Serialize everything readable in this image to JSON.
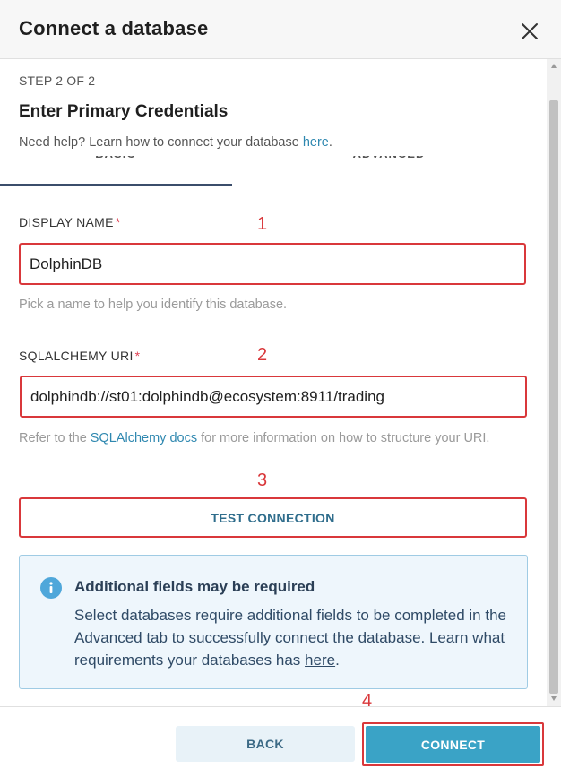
{
  "modal": {
    "title": "Connect a database",
    "close_icon": "close-icon"
  },
  "step": {
    "label": "STEP 2 OF 2",
    "title": "Enter Primary Credentials",
    "help_text": "Need help? Learn how to connect your database ",
    "help_link": "here",
    "help_suffix": "."
  },
  "tabs": [
    {
      "label": "BASIC",
      "active": true
    },
    {
      "label": "ADVANCED",
      "active": false
    }
  ],
  "fields": {
    "display_name": {
      "label": "DISPLAY NAME",
      "required_mark": "*",
      "value": "DolphinDB",
      "hint": "Pick a name to help you identify this database."
    },
    "sqlalchemy_uri": {
      "label": "SQLALCHEMY URI",
      "required_mark": "*",
      "value": "dolphindb://st01:dolphindb@ecosystem:8911/trading",
      "hint_prefix": "Refer to the ",
      "hint_link": "SQLAlchemy docs",
      "hint_suffix": " for more information on how to structure your URI."
    }
  },
  "test_connection_label": "TEST CONNECTION",
  "alert": {
    "icon": "info-icon",
    "title": "Additional fields may be required",
    "text": "Select databases require additional fields to be completed in the Advanced tab to successfully connect the database. Learn what requirements your databases has ",
    "link": "here",
    "suffix": "."
  },
  "annotations": [
    "1",
    "2",
    "3",
    "4"
  ],
  "footer": {
    "back_label": "BACK",
    "connect_label": "CONNECT"
  },
  "colors": {
    "annotation_red": "#d9383b",
    "accent_blue": "#3aa3c6",
    "link_blue": "#2f88b0",
    "alert_bg": "#eef6fc",
    "required_red": "#e04355"
  }
}
